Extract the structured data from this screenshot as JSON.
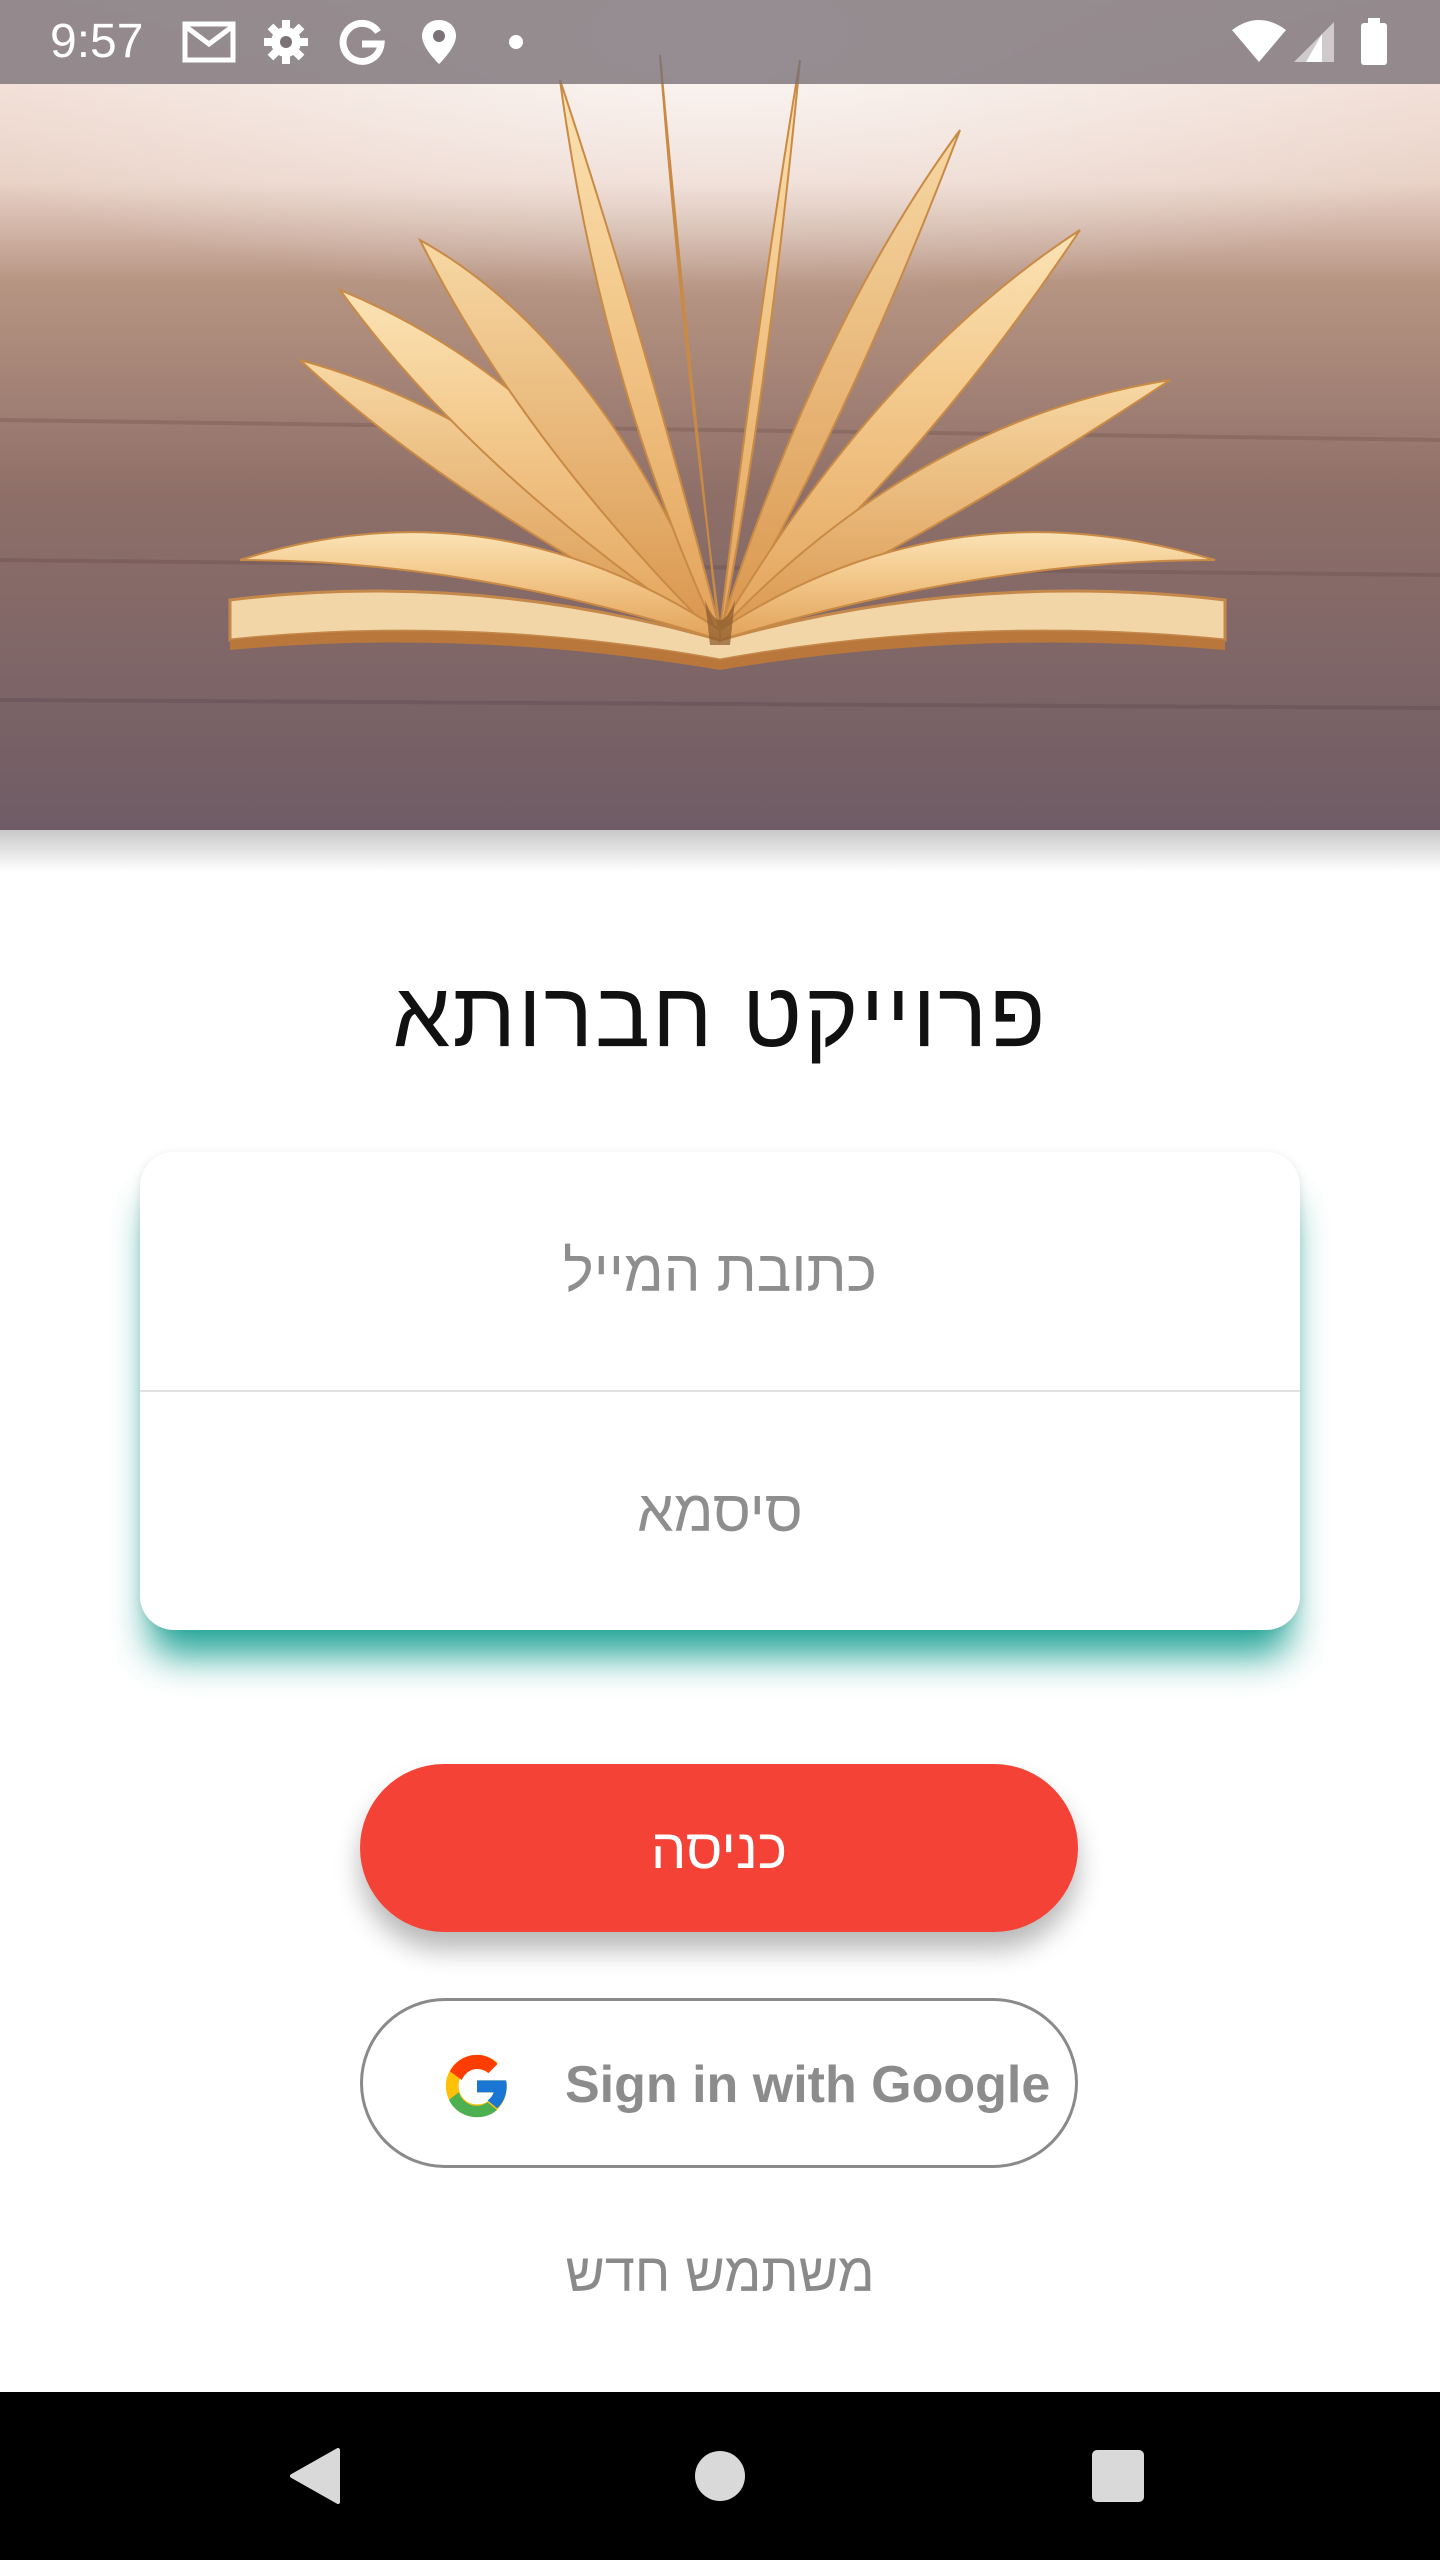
{
  "status_bar": {
    "time": "9:57",
    "icons": [
      "gmail-icon",
      "settings-icon",
      "google-icon",
      "location-icon",
      "dot-icon",
      "wifi-icon",
      "signal-icon",
      "battery-icon"
    ]
  },
  "hero": {
    "image": "open-book-on-wooden-table"
  },
  "app": {
    "title": "פרוייקט חברותא"
  },
  "form": {
    "email_placeholder": "כתובת המייל",
    "password_placeholder": "סיסמא"
  },
  "buttons": {
    "login_label": "כניסה",
    "google_label": "Sign in with Google",
    "new_user_label": "משתמש חדש"
  },
  "nav_bar": {
    "icons": [
      "back-icon",
      "home-icon",
      "recents-icon"
    ]
  },
  "colors": {
    "accent_red": "#f44336",
    "card_shadow_teal": "#009688",
    "status_bar_bg": "#7a7276",
    "nav_bar_bg": "#000000"
  }
}
